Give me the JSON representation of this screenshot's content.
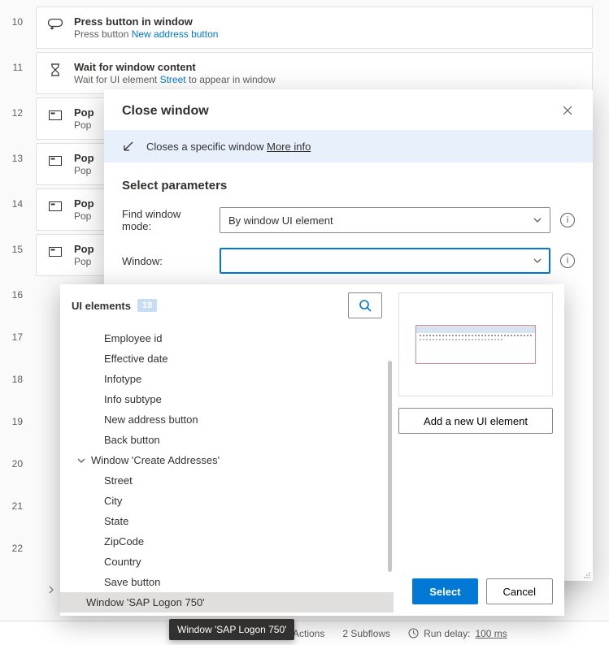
{
  "steps": [
    {
      "num": "10",
      "icon": "press-button-icon",
      "title": "Press button in window",
      "desc_a": "Press button ",
      "link": "New address button"
    },
    {
      "num": "11",
      "icon": "hourglass-icon",
      "title": "Wait for window content",
      "desc_a": "Wait for UI element ",
      "link": "Street",
      "desc_b": " to appear in window"
    },
    {
      "num": "12",
      "icon": "populate-icon",
      "title": "Pop",
      "desc_a": "Pop"
    },
    {
      "num": "13",
      "icon": "populate-icon",
      "title": "Pop",
      "desc_a": "Pop"
    },
    {
      "num": "14",
      "icon": "populate-icon",
      "title": "Pop",
      "desc_a": "Pop"
    },
    {
      "num": "15",
      "icon": "populate-icon",
      "title": "Pop",
      "desc_a": "Pop"
    },
    {
      "num": "16"
    },
    {
      "num": "17"
    },
    {
      "num": "18"
    },
    {
      "num": "19"
    },
    {
      "num": "20"
    },
    {
      "num": "21"
    },
    {
      "num": "22"
    }
  ],
  "close_window_label": "Close window",
  "dialog": {
    "title": "Close window",
    "banner_text": "Closes a specific window ",
    "more_info": "More info",
    "params_heading": "Select parameters",
    "find_mode_label": "Find window mode:",
    "find_mode_value": "By window UI element",
    "window_label": "Window:",
    "window_value": ""
  },
  "popup": {
    "title": "UI elements",
    "count": "19",
    "items_flat": [
      "Employee id",
      "Effective date",
      "Infotype",
      "Info subtype",
      "New address button",
      "Back button"
    ],
    "group_label": "Window 'Create Addresses'",
    "items_child": [
      "Street",
      "City",
      "State",
      "ZipCode",
      "Country",
      "Save button"
    ],
    "selected": "Window 'SAP Logon 750'",
    "add_label": "Add a new UI element",
    "select_label": "Select",
    "cancel_label": "Cancel"
  },
  "tooltip": "Window 'SAP Logon 750'",
  "status": {
    "actions": "Actions",
    "subflows": "2 Subflows",
    "run_delay_label": "Run delay:",
    "run_delay_val": "100 ms"
  }
}
